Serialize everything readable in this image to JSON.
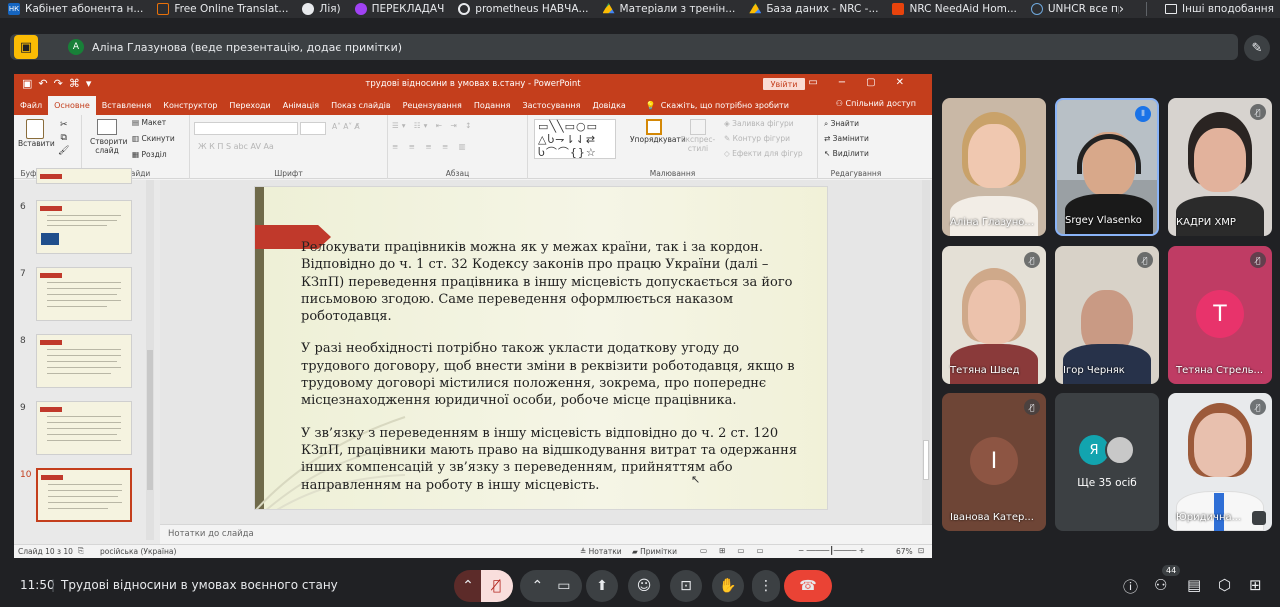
{
  "bookmarks": [
    {
      "label": "Кабінет абонента н...",
      "icon": "hk-icon",
      "color": "#1565c0"
    },
    {
      "label": "Free Online Translat...",
      "icon": "translate-icon",
      "color": "#e8710a"
    },
    {
      "label": "Лія)",
      "icon": "github-icon",
      "color": "#e8eaed"
    },
    {
      "label": "ПЕРЕКЛАДАЧ",
      "icon": "globe-icon",
      "color": "#a142f4"
    },
    {
      "label": "prometheus НАВЧА...",
      "icon": "prometheus-icon",
      "color": "#e8eaed"
    },
    {
      "label": "Матеріали з тренін...",
      "icon": "drive-icon",
      "color": "#34a853"
    },
    {
      "label": "База даних - NRC -...",
      "icon": "drive-icon",
      "color": "#fbbc04"
    },
    {
      "label": "NRC NeedAid Hom...",
      "icon": "nrc-icon",
      "color": "#e8430c"
    },
    {
      "label": "UNHCR  все про ГЗН",
      "icon": "unhcr-icon",
      "color": "#0072bc"
    }
  ],
  "bookmarks_more": "›",
  "other_bookmarks": "Інші вподобання",
  "presenter_initial": "A",
  "presenter_text": "Аліна Глазунова (веде презентацію, додає примітки)",
  "ppt": {
    "title": "трудові відносини в умовах в.стану  -  PowerPoint",
    "login": "Увійти",
    "tabs": [
      "Файл",
      "Основне",
      "Вставлення",
      "Конструктор",
      "Переходи",
      "Анімація",
      "Показ слайдів",
      "Рецензування",
      "Подання",
      "Застосування",
      "Довідка"
    ],
    "tell": "Скажіть, що потрібно зробити",
    "share": "Спільний доступ",
    "groups": {
      "clipboard": "Буфер обміну",
      "slides": "Слайди",
      "font": "Шрифт",
      "paragraph": "Абзац",
      "drawing": "Малювання",
      "editing": "Редагування"
    },
    "paste": "Вставити",
    "new_slide": "Створити слайд",
    "layout": "Макет",
    "reset": "Скинути",
    "section": "Розділ",
    "font_btns": "Ж  К  П  S  abc  AV   Aa",
    "arrange": "Упорядкувати",
    "quick_styles": "Експрес-стилі",
    "shape_fill": "Заливка фігури",
    "shape_outline": "Контур фігури",
    "shape_effects": "Ефекти для фігур",
    "find": "Знайти",
    "replace": "Замінити",
    "select": "Виділити",
    "thumbs": [
      "6",
      "7",
      "8",
      "9",
      "10"
    ],
    "slide_text": [
      "Релокувати працівників можна як у межах країни, так і за кордон. Відповідно до ч. 1 ст. 32 Кодексу законів про працю України (далі – КЗпП) переведення працівника в іншу місцевість допускається за його письмовою згодою. Саме переведення оформлюється наказом роботодавця.",
      "У разі необхідності потрібно також укласти додаткову угоду до трудового договору, щоб внести зміни в реквізити роботодавця, якщо в трудовому договорі містилися положення, зокрема, про попереднє місцезнаходження юридичної особи, робоче місце працівника.",
      "У зв’язку з переведенням в іншу місцевість відповідно до ч. 2 ст. 120 КЗпП, працівники мають право на відшкодування витрат та одержання інших компенсацій у зв’язку з переведенням, прийняттям або направленням на роботу в іншу місцевість."
    ],
    "notes_placeholder": "Нотатки до слайда",
    "status_slide": "Слайд 10 з 10",
    "status_lang": "російська (Україна)",
    "status_notes": "Нотатки",
    "status_comments": "Примітки",
    "zoom": "67%"
  },
  "participants": [
    {
      "name": "Аліна Глазуно...",
      "type": "video",
      "muted": false
    },
    {
      "name": "Srgey Vlasenko",
      "type": "video",
      "speaking": true
    },
    {
      "name": "КАДРИ ХМР",
      "type": "video",
      "muted": true
    },
    {
      "name": "Тетяна Швед",
      "type": "video",
      "muted": true
    },
    {
      "name": "Ігор Черняк",
      "type": "video",
      "muted": true
    },
    {
      "name": "Тетяна Стрель...",
      "type": "avatar",
      "initial": "T",
      "color": "#e8336b",
      "muted": true
    },
    {
      "name": "Іванова Катер...",
      "type": "avatar",
      "initial": "І",
      "color": "#8d5543",
      "muted": true
    },
    {
      "name": "Ще 35 осіб",
      "type": "more",
      "initial": "Я"
    },
    {
      "name": "Юридична...",
      "type": "video",
      "muted": true
    }
  ],
  "meeting": {
    "time": "11:50",
    "separator": "|",
    "title": "Трудові відносини в умовах воєнного стану",
    "people_count": "44"
  }
}
